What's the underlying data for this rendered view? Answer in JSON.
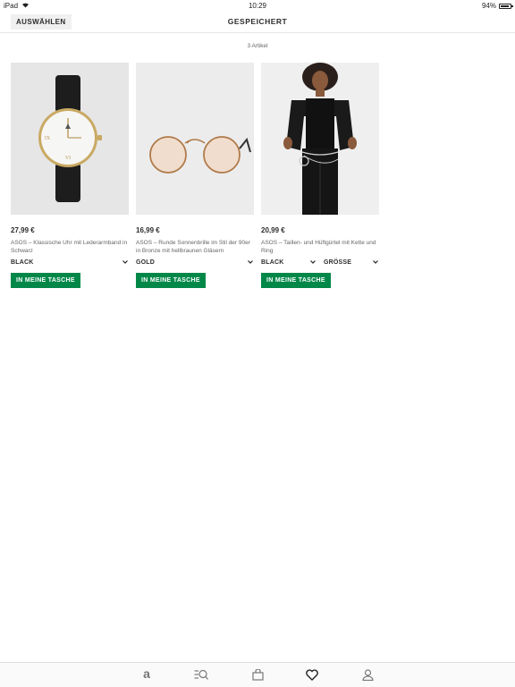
{
  "status_bar": {
    "device": "iPad",
    "time": "10:29",
    "battery_text": "94%",
    "battery_level": 0.94
  },
  "nav": {
    "select_label": "AUSWÄHLEN",
    "title": "GESPEICHERT"
  },
  "item_count": "3 Artikel",
  "products": [
    {
      "price": "27,99 €",
      "description": "ASOS – Klassische Uhr mit Lederarmband in Schwarz",
      "color": "BLACK",
      "add_label": "IN MEINE TASCHE",
      "image": "watch-image"
    },
    {
      "price": "16,99 €",
      "description": "ASOS – Runde Sonnenbrille im Stil der 90er in Bronze mit hellbraunen Gläsern",
      "color": "GOLD",
      "add_label": "IN MEINE TASCHE",
      "image": "sunglasses-image"
    },
    {
      "price": "20,99 €",
      "description": "ASOS – Taillen- und Hüftgürtel mit Kette und Ring",
      "color": "BLACK",
      "size": "GRÖSSE",
      "add_label": "IN MEINE TASCHE",
      "image": "model-belt-image"
    }
  ],
  "tab_bar": {
    "tabs": [
      "home-icon",
      "search-icon",
      "bag-icon",
      "heart-icon",
      "account-icon"
    ],
    "active": "heart-icon"
  },
  "colors": {
    "accent_green": "#018849",
    "text_dark": "#2d2d2d"
  }
}
